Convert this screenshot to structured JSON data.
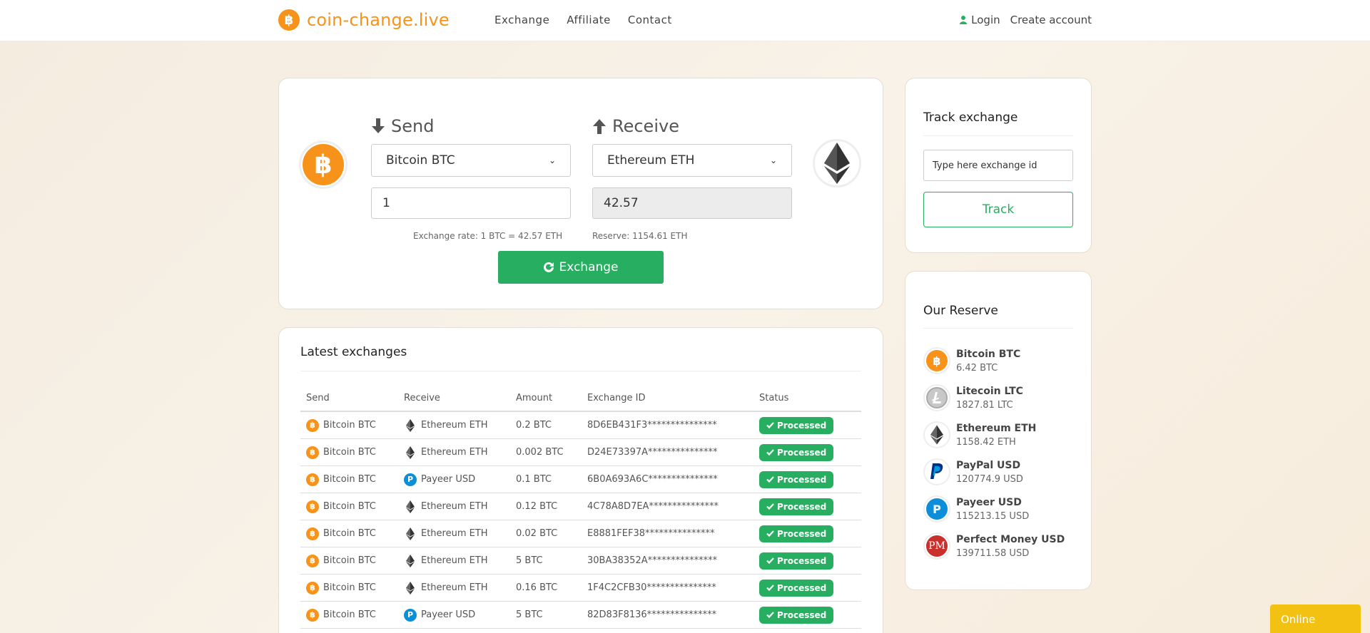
{
  "header": {
    "logo_glyph": "฿",
    "logo_text": "coin-change.live",
    "nav": [
      "Exchange",
      "Affiliate",
      "Contact"
    ],
    "login": "Login",
    "create_account": "Create account"
  },
  "exchange": {
    "send_title": "Send",
    "receive_title": "Receive",
    "send_currency": "Bitcoin BTC",
    "receive_currency": "Ethereum ETH",
    "send_amount": "1",
    "receive_amount": "42.57",
    "exchange_rate": "Exchange rate: 1 BTC = 42.57 ETH",
    "reserve": "Reserve: 1154.61 ETH",
    "button": "Exchange"
  },
  "latest": {
    "title": "Latest exchanges",
    "columns": [
      "Send",
      "Receive",
      "Amount",
      "Exchange ID",
      "Status"
    ],
    "rows": [
      {
        "send": "Bitcoin BTC",
        "receive": "Ethereum ETH",
        "receive_icon": "eth",
        "amount": "0.2 BTC",
        "id": "8D6EB431F3***************",
        "status": "Processed"
      },
      {
        "send": "Bitcoin BTC",
        "receive": "Ethereum ETH",
        "receive_icon": "eth",
        "amount": "0.002 BTC",
        "id": "D24E73397A***************",
        "status": "Processed"
      },
      {
        "send": "Bitcoin BTC",
        "receive": "Payeer USD",
        "receive_icon": "payeer",
        "amount": "0.1 BTC",
        "id": "6B0A693A6C***************",
        "status": "Processed"
      },
      {
        "send": "Bitcoin BTC",
        "receive": "Ethereum ETH",
        "receive_icon": "eth",
        "amount": "0.12 BTC",
        "id": "4C78A8D7EA***************",
        "status": "Processed"
      },
      {
        "send": "Bitcoin BTC",
        "receive": "Ethereum ETH",
        "receive_icon": "eth",
        "amount": "0.02 BTC",
        "id": "E8881FEF38***************",
        "status": "Processed"
      },
      {
        "send": "Bitcoin BTC",
        "receive": "Ethereum ETH",
        "receive_icon": "eth",
        "amount": "5 BTC",
        "id": "30BA38352A***************",
        "status": "Processed"
      },
      {
        "send": "Bitcoin BTC",
        "receive": "Ethereum ETH",
        "receive_icon": "eth",
        "amount": "0.16 BTC",
        "id": "1F4C2CFB30***************",
        "status": "Processed"
      },
      {
        "send": "Bitcoin BTC",
        "receive": "Payeer USD",
        "receive_icon": "payeer",
        "amount": "5 BTC",
        "id": "82D83F8136***************",
        "status": "Processed"
      }
    ]
  },
  "track": {
    "title": "Track exchange",
    "input_placeholder": "Type here exchange id",
    "button": "Track"
  },
  "reserve": {
    "title": "Our Reserve",
    "items": [
      {
        "name": "Bitcoin BTC",
        "amount": "6.42 BTC",
        "icon": "btc"
      },
      {
        "name": "Litecoin LTC",
        "amount": "1827.81 LTC",
        "icon": "ltc"
      },
      {
        "name": "Ethereum ETH",
        "amount": "1158.42 ETH",
        "icon": "eth"
      },
      {
        "name": "PayPal USD",
        "amount": "120774.9 USD",
        "icon": "paypal"
      },
      {
        "name": "Payeer USD",
        "amount": "115213.15 USD",
        "icon": "payeer"
      },
      {
        "name": "Perfect Money USD",
        "amount": "139711.58 USD",
        "icon": "pm"
      }
    ]
  },
  "online_label": "Online",
  "colors": {
    "accent": "#f7931a",
    "success": "#27ae60",
    "online": "#f2c111"
  }
}
